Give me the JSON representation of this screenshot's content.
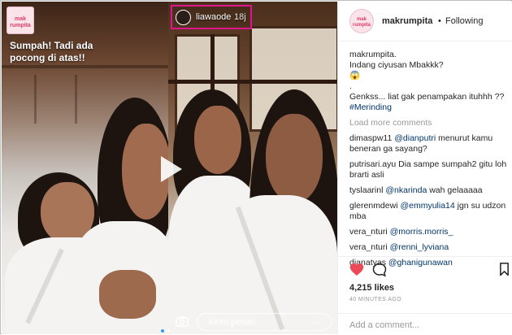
{
  "story": {
    "brand_line1": "mak",
    "brand_line2": "rumpita",
    "overlay_text": "Sumpah! Tadi ada pocong di atas!!",
    "username": "liawaode",
    "time": "18j",
    "reply_placeholder": "Kirim pesan",
    "reply_more": "...",
    "icons": [
      "play-icon",
      "camera-icon",
      "more-icon"
    ]
  },
  "post": {
    "username": "makrumpita",
    "separator": "•",
    "follow_status": "Following",
    "caption": {
      "author": "makrumpita",
      "author_suffix": ".",
      "line1": "Indang ciyusan Mbakkk?",
      "line2": "😱",
      "line3": ".",
      "line4": "Genkss... liat gak penampakan ituhhh ??",
      "hashtag": "#Merinding"
    },
    "load_more": "Load more comments",
    "comments": [
      {
        "user": "dimaspw11",
        "mention": "@dianputri",
        "text": " menurut kamu",
        "cont": "beneran ga sayang?"
      },
      {
        "user": "putrisari.ayu",
        "mention": "",
        "text": " Dia sampe sumpah2 gitu loh",
        "cont": "brarti asli"
      },
      {
        "user": "tyslaarinl",
        "mention": "@nkarinda",
        "text": " wah gelaaaaa",
        "cont": ""
      },
      {
        "user": "glerenmdewi",
        "mention": "@emmyulia14",
        "text": " jgn su udzon",
        "cont": "mba"
      },
      {
        "user": "vera_nturi",
        "mention": "@morris.morris_",
        "text": "",
        "cont": ""
      },
      {
        "user": "vera_nturi",
        "mention": "@renni_lyviana",
        "text": "",
        "cont": ""
      },
      {
        "user": "dianatyas",
        "mention": "@ghanigunawan",
        "text": "",
        "cont": ""
      }
    ],
    "likes": "4,215 likes",
    "time_ago": "40 MINUTES AGO",
    "add_comment_placeholder": "Add a comment...",
    "icons": [
      "heart-icon",
      "comment-icon",
      "bookmark-icon"
    ],
    "colors": {
      "heart": "#ed4956",
      "link": "#003569",
      "muted": "#999999",
      "story_highlight": "#e0148b"
    }
  }
}
